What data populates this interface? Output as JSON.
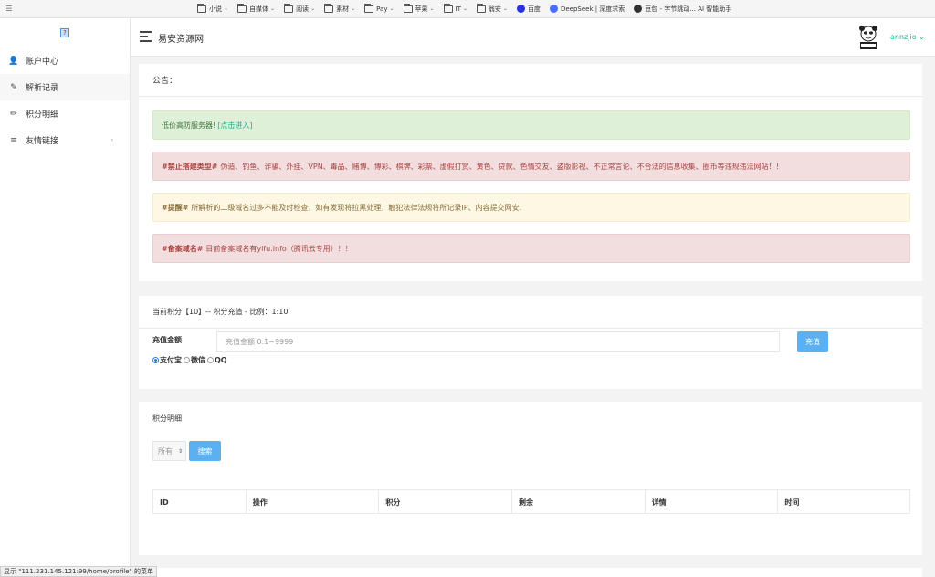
{
  "bookmarks": [
    {
      "label": "小说",
      "type": "folder",
      "caret": "⌄"
    },
    {
      "label": "自媒体",
      "type": "folder",
      "caret": "⌄"
    },
    {
      "label": "阅读",
      "type": "folder",
      "caret": "⌄"
    },
    {
      "label": "素材",
      "type": "folder",
      "caret": "⌄"
    },
    {
      "label": "Pay",
      "type": "folder",
      "caret": "⌄"
    },
    {
      "label": "苹果",
      "type": "folder",
      "caret": "⌄"
    },
    {
      "label": "IT",
      "type": "folder",
      "caret": "⌄"
    },
    {
      "label": "翁安",
      "type": "folder",
      "caret": "⌄"
    },
    {
      "label": "百度",
      "type": "site",
      "color": "#2932e1"
    },
    {
      "label": "DeepSeek | 深度求索",
      "type": "site",
      "color": "#4d6bfe"
    },
    {
      "label": "豆包 - 字节跳动... AI 智能助手",
      "type": "site",
      "color": "#333333"
    }
  ],
  "sidebar": {
    "logo_icon": "site-logo",
    "items": [
      {
        "label": "账户中心",
        "icon": "user-icon",
        "glyph": "👤"
      },
      {
        "label": "解析记录",
        "icon": "edit-box-icon",
        "glyph": "✎"
      },
      {
        "label": "积分明细",
        "icon": "pencil-icon",
        "glyph": "✏"
      },
      {
        "label": "友情链接",
        "icon": "list-icon",
        "glyph": "≡",
        "caret": "‹"
      }
    ]
  },
  "header": {
    "site_title": "易安资源网",
    "username": "annzjio ⌄"
  },
  "notice": {
    "title": "公告：",
    "alerts": [
      {
        "type": "success",
        "prefix": "",
        "text": "低价高防服务器! ",
        "link": "[点击进入]"
      },
      {
        "type": "danger",
        "prefix": "#禁止搭建类型#",
        "text": "伪造、钓鱼、诈骗、外挂、VPN、毒品、赌博、博彩、棋牌、彩票、虚假打赏、黄色、贷款、色情交友、盗版影视、不正常言论、不合法的信息收集、圈币等违规违法网站！！"
      },
      {
        "type": "warning",
        "prefix": "#提醒#",
        "text": "所解析的二级域名过多不能及时检查，如有发现将拉黑处理，触犯法律法规将所记录IP、内容提交网安."
      },
      {
        "type": "danger",
        "prefix": "#备案域名#",
        "text": "目前备案域名有yifu.info（腾讯云专用）！！"
      }
    ]
  },
  "recharge": {
    "header": "当前积分【10】-- 积分充值 - 比例：1:10",
    "amount_label": "充值金额",
    "amount_placeholder": "充值金额 0.1~9999",
    "submit_label": "充值",
    "pay_methods": [
      "支付宝",
      "微信",
      "QQ"
    ],
    "selected_method": "支付宝"
  },
  "points": {
    "header": "积分明细",
    "filter_value": "所有",
    "search_label": "搜索",
    "columns": [
      "ID",
      "操作",
      "积分",
      "剩余",
      "详情",
      "时间"
    ]
  },
  "status_bar": "显示 \"111.231.145.121:99/home/profile\" 的菜单",
  "colors": {
    "accent": "#1ab394",
    "button": "#5ab0f1"
  }
}
